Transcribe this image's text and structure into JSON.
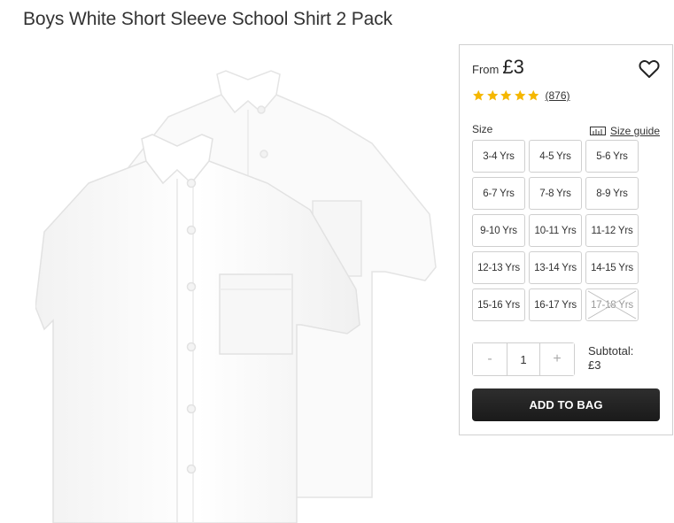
{
  "product": {
    "title": "Boys White Short Sleeve School Shirt 2 Pack"
  },
  "price": {
    "from_label": "From",
    "value": "£3"
  },
  "rating": {
    "stars": 5,
    "review_count": "(876)",
    "star_color": "#f5b700"
  },
  "size": {
    "label": "Size",
    "guide_label": "Size guide",
    "options": [
      {
        "label": "3-4 Yrs",
        "available": true
      },
      {
        "label": "4-5 Yrs",
        "available": true
      },
      {
        "label": "5-6 Yrs",
        "available": true
      },
      {
        "label": "6-7 Yrs",
        "available": true
      },
      {
        "label": "7-8 Yrs",
        "available": true
      },
      {
        "label": "8-9 Yrs",
        "available": true
      },
      {
        "label": "9-10 Yrs",
        "available": true
      },
      {
        "label": "10-11 Yrs",
        "available": true
      },
      {
        "label": "11-12 Yrs",
        "available": true
      },
      {
        "label": "12-13 Yrs",
        "available": true
      },
      {
        "label": "13-14 Yrs",
        "available": true
      },
      {
        "label": "14-15 Yrs",
        "available": true
      },
      {
        "label": "15-16 Yrs",
        "available": true
      },
      {
        "label": "16-17 Yrs",
        "available": true
      },
      {
        "label": "17-18 Yrs",
        "available": false
      }
    ]
  },
  "quantity": {
    "minus_label": "-",
    "value": "1",
    "plus_label": "+"
  },
  "subtotal": {
    "label": "Subtotal:",
    "value": "£3"
  },
  "cart": {
    "add_label": "ADD TO BAG"
  },
  "icons": {
    "wishlist": "heart-icon",
    "size_guide": "ruler-icon",
    "rating": "star-icon"
  }
}
